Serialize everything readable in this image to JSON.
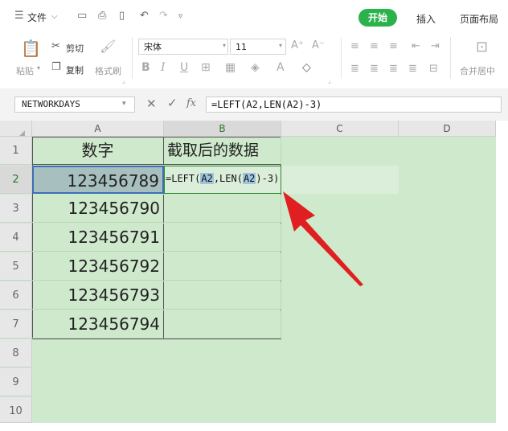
{
  "menubar": {
    "file_label": "文件",
    "tabs": [
      "开始",
      "插入",
      "页面布局"
    ]
  },
  "ribbon": {
    "paste_label": "粘贴",
    "cut_label": "剪切",
    "copy_label": "复制",
    "format_painter_label": "格式刷",
    "font_name": "宋体",
    "font_size": "11",
    "bold": "B",
    "italic": "I",
    "underline": "U",
    "merge_label": "合并居中"
  },
  "formula_bar": {
    "name_box": "NETWORKDAYS",
    "fx": "fx",
    "formula": "=LEFT(A2,LEN(A2)-3)"
  },
  "columns": [
    "A",
    "B",
    "C",
    "D"
  ],
  "rows": [
    "1",
    "2",
    "3",
    "4",
    "5",
    "6",
    "7",
    "8",
    "9",
    "10"
  ],
  "table": {
    "headers": [
      "数字",
      "截取后的数据"
    ],
    "values": [
      "123456789",
      "123456790",
      "123456791",
      "123456792",
      "123456793",
      "123456794"
    ],
    "editing_formula": {
      "prefix": "=LEFT(",
      "ref1": "A2",
      "mid": ",LEN(",
      "ref2": "A2",
      "suffix": ")-3)"
    }
  },
  "colors": {
    "accent": "#2bb24c",
    "sheet_bg": "#cfe9cd",
    "arrow": "#e02020"
  }
}
